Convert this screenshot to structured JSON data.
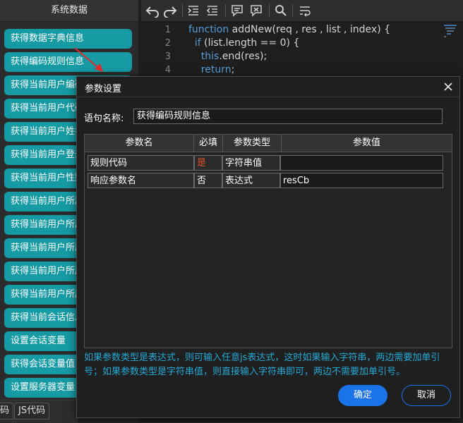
{
  "sidebar": {
    "title": "系统数据",
    "items": [
      {
        "label": "获得数据字典信息"
      },
      {
        "label": "获得编码规则信息"
      },
      {
        "label": "获得当前用户编码"
      },
      {
        "label": "获得当前用户代码"
      },
      {
        "label": "获得当前用户姓名"
      },
      {
        "label": "获得当前用户登录名"
      },
      {
        "label": "获得当前用户性别"
      },
      {
        "label": "获得当前用户所属部门"
      },
      {
        "label": "获得当前用户所属机构"
      },
      {
        "label": "获得当前用户所属角色"
      },
      {
        "label": "获得当前用户所属岗位"
      },
      {
        "label": "获得当前用户所属组"
      },
      {
        "label": "获得当前会话信息"
      },
      {
        "label": "设置会话变量"
      },
      {
        "label": "获得会话变量值"
      },
      {
        "label": "设置服务器变量"
      }
    ]
  },
  "bottom_tabs": [
    {
      "label": "码"
    },
    {
      "label": "JS代码"
    }
  ],
  "toolbar": {
    "icons": [
      "undo-icon",
      "redo-icon",
      "indent-icon",
      "outdent-icon",
      "comment-icon",
      "uncomment-icon",
      "search-icon",
      "wrap-icon"
    ]
  },
  "editor": {
    "lines": [
      {
        "num": "1",
        "tokens": [
          {
            "t": "function ",
            "c": "kw"
          },
          {
            "t": "addNew(req , res , list , index) {",
            "c": ""
          }
        ]
      },
      {
        "num": "2",
        "tokens": [
          {
            "t": "  if ",
            "c": "kw"
          },
          {
            "t": "(list.length == 0) {",
            "c": ""
          }
        ]
      },
      {
        "num": "3",
        "tokens": [
          {
            "t": "    this",
            "c": "kw"
          },
          {
            "t": ".end(res);",
            "c": ""
          }
        ]
      },
      {
        "num": "4",
        "tokens": [
          {
            "t": "    return",
            "c": "kw"
          },
          {
            "t": ";",
            "c": ""
          }
        ]
      }
    ]
  },
  "dialog": {
    "title": "参数设置",
    "name_label": "语句名称:",
    "name_value": "获得编码规则信息",
    "columns": [
      "参数名",
      "必填",
      "参数类型",
      "参数值"
    ],
    "rows": [
      {
        "name": "规则代码",
        "required": "是",
        "type": "字符串值",
        "value": ""
      },
      {
        "name": "响应参数名",
        "required": "否",
        "type": "表达式",
        "value": "resCb"
      }
    ],
    "help_text": "如果参数类型是表达式，则可输入任意js表达式，这时如果输入字符串，两边需要加单引号；如果参数类型是字符串值，则直接输入字符串即可，两边不需要加单引号。",
    "ok_label": "确定",
    "cancel_label": "取消"
  },
  "colors": {
    "sidebar_item": "#169aa3",
    "keyword": "#569cd6",
    "help_text": "#25a9d6",
    "required_yes": "#e0502a",
    "primary_button": "#1a73e8"
  }
}
